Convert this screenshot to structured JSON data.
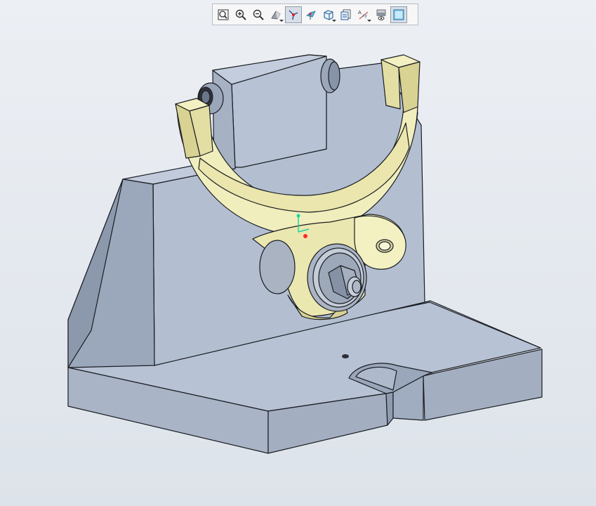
{
  "app": {
    "view": "3d-model-viewport"
  },
  "toolbar": {
    "buttons": [
      {
        "name": "zoom-fit",
        "icon": "zoom-fit-icon",
        "active": false
      },
      {
        "name": "zoom-in",
        "icon": "zoom-in-icon",
        "active": false
      },
      {
        "name": "zoom-out",
        "icon": "zoom-out-icon",
        "active": false
      },
      {
        "name": "display-style",
        "icon": "display-style-icon",
        "active": false,
        "dropdown": true
      },
      {
        "name": "datum-axes",
        "icon": "datum-axes-icon",
        "active": true
      },
      {
        "name": "datum-points",
        "icon": "datum-points-icon",
        "active": false
      },
      {
        "name": "saved-views",
        "icon": "saved-views-icon",
        "active": false,
        "dropdown": true
      },
      {
        "name": "view-manager",
        "icon": "view-manager-icon",
        "active": false
      },
      {
        "name": "annotation-display",
        "icon": "annotation-display-icon",
        "active": false,
        "dropdown": true
      },
      {
        "name": "layer-display",
        "icon": "layer-display-icon",
        "active": false
      },
      {
        "name": "shaded-display",
        "icon": "shaded-display-icon",
        "active": true
      }
    ]
  },
  "colors": {
    "fixture_light": "#b7c2d4",
    "fixture_mid": "#a3afc1",
    "fixture_dark": "#8896aa",
    "fork_light": "#f3f0c2",
    "fork_mid": "#e8e4a9",
    "fork_dark": "#cfc98d",
    "edge": "#1a1d22",
    "csys_green": "#16d9a0",
    "csys_red": "#ff2a2a"
  }
}
